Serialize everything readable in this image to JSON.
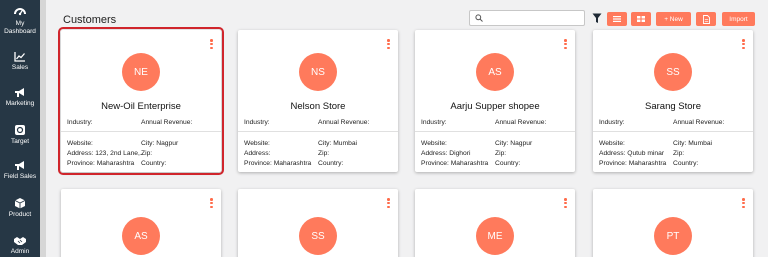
{
  "sidebar": {
    "items": [
      {
        "label_line1": "My",
        "label_line2": "Dashboard",
        "icon": "dashboard-icon"
      },
      {
        "label": "Sales",
        "icon": "chart-line-icon"
      },
      {
        "label": "Marketing",
        "icon": "megaphone-icon"
      },
      {
        "label": "Target",
        "icon": "target-icon"
      },
      {
        "label": "Field Sales",
        "icon": "megaphone-icon"
      },
      {
        "label": "Product",
        "icon": "box-icon"
      },
      {
        "label": "Admin",
        "icon": "handshake-icon"
      }
    ]
  },
  "page": {
    "title": "Customers"
  },
  "toolbar": {
    "search_placeholder": "",
    "new_label": "+ New",
    "import_label": "Import",
    "accent": "#ff7a5c"
  },
  "labels": {
    "industry": "Industry:",
    "annual_revenue": "Annual Revenue:",
    "website": "Website:",
    "zip": "Zip:",
    "address": "Address:",
    "country": "Country:",
    "province": "Province:",
    "city": "City:"
  },
  "cards": [
    {
      "initials": "NE",
      "name": "New-Oil Enterprise",
      "website": "Website:",
      "city": "City: Nagpur",
      "address": "Address: 123, 2nd Lane,...",
      "zip": "Zip:",
      "province": "Province: Maharashtra",
      "country": "Country:"
    },
    {
      "initials": "NS",
      "name": "Nelson Store",
      "website": "Website:",
      "city": "City: Mumbai",
      "address": "Address:",
      "zip": "Zip:",
      "province": "Province: Maharashtra",
      "country": "Country:"
    },
    {
      "initials": "AS",
      "name": "Aarju Supper shopee",
      "website": "Website:",
      "city": "City: Nagpur",
      "address": "Address: Dighori",
      "zip": "Zip:",
      "province": "Province: Maharashtra",
      "country": "Country:"
    },
    {
      "initials": "SS",
      "name": "Sarang Store",
      "website": "Website:",
      "city": "City: Mumbai",
      "address": "Address: Qutub minar",
      "zip": "Zip:",
      "province": "Province: Maharashtra",
      "country": "Country:"
    },
    {
      "initials": "AS"
    },
    {
      "initials": "SS"
    },
    {
      "initials": "ME"
    },
    {
      "initials": "PT"
    }
  ]
}
